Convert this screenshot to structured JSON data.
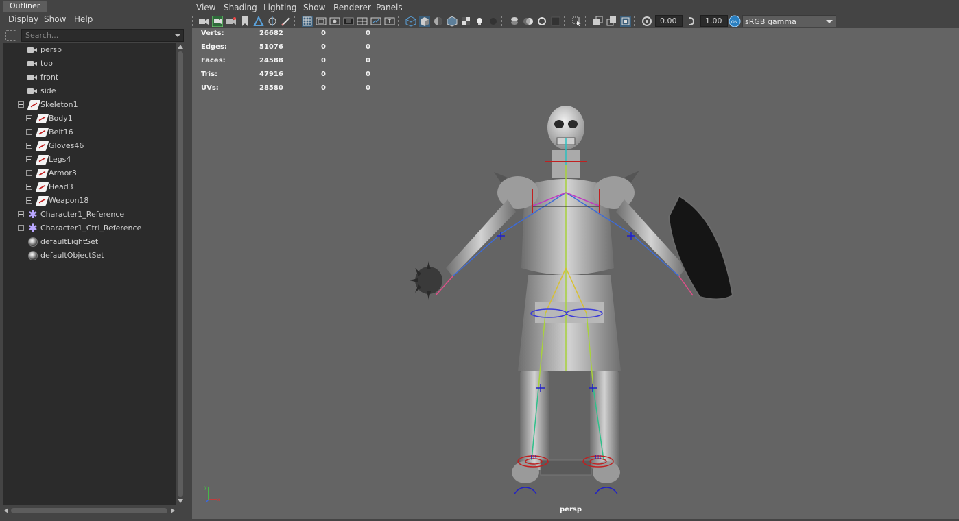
{
  "outliner": {
    "tab_title": "Outliner",
    "menu": [
      "Display",
      "Show",
      "Help"
    ],
    "search_placeholder": "Search...",
    "items": [
      {
        "label": "persp",
        "icon": "camera-icon"
      },
      {
        "label": "top",
        "icon": "camera-icon"
      },
      {
        "label": "front",
        "icon": "camera-icon"
      },
      {
        "label": "side",
        "icon": "camera-icon"
      },
      {
        "label": "Skeleton1",
        "icon": "joint-icon",
        "expanded": true
      },
      {
        "label": "Body1",
        "icon": "joint-icon"
      },
      {
        "label": "Belt16",
        "icon": "joint-icon"
      },
      {
        "label": "Gloves46",
        "icon": "joint-icon"
      },
      {
        "label": "Legs4",
        "icon": "joint-icon"
      },
      {
        "label": "Armor3",
        "icon": "joint-icon"
      },
      {
        "label": "Head3",
        "icon": "joint-icon"
      },
      {
        "label": "Weapon18",
        "icon": "joint-icon"
      },
      {
        "label": "Character1_Reference",
        "icon": "character-reference-icon"
      },
      {
        "label": "Character1_Ctrl_Reference",
        "icon": "character-reference-icon"
      },
      {
        "label": "defaultLightSet",
        "icon": "set-icon"
      },
      {
        "label": "defaultObjectSet",
        "icon": "set-icon"
      }
    ]
  },
  "viewport": {
    "menu": [
      "View",
      "Shading",
      "Lighting",
      "Show",
      "Renderer",
      "Panels"
    ],
    "toolbar": {
      "exposure_value": "0.00",
      "gamma_value": "1.00",
      "color_space": "sRGB gamma"
    },
    "stats": [
      {
        "label": "Verts:",
        "value": "26682",
        "selected": "0",
        "components": "0"
      },
      {
        "label": "Edges:",
        "value": "51076",
        "selected": "0",
        "components": "0"
      },
      {
        "label": "Faces:",
        "value": "24588",
        "selected": "0",
        "components": "0"
      },
      {
        "label": "Tris:",
        "value": "47916",
        "selected": "0",
        "components": "0"
      },
      {
        "label": "UVs:",
        "value": "28580",
        "selected": "0",
        "components": "0"
      }
    ],
    "camera_name": "persp",
    "colors": {
      "viewport_bg": "#646464",
      "panel_bg": "#444444",
      "highlight": "#5aa0d8"
    }
  }
}
